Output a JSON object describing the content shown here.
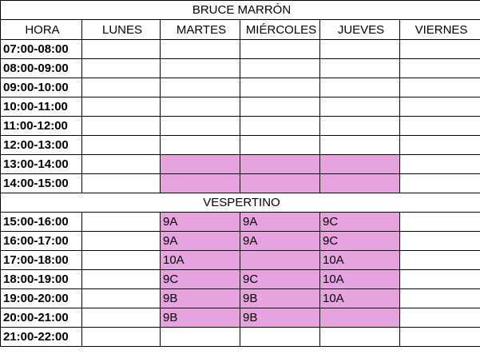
{
  "title": "BRUCE MARRÓN",
  "section_label": "VESPERTINO",
  "colors": {
    "highlight": "#e6a3e0",
    "border": "#000000"
  },
  "headers": [
    "HORA",
    "LUNES",
    "MARTES",
    "MIÉRCOLES",
    "JUEVES",
    "VIERNES"
  ],
  "morning_rows": [
    {
      "time": "07:00-08:00",
      "cells": [
        "",
        "",
        "",
        "",
        ""
      ],
      "highlight": [
        false,
        false,
        false,
        false,
        false
      ]
    },
    {
      "time": "08:00-09:00",
      "cells": [
        "",
        "",
        "",
        "",
        ""
      ],
      "highlight": [
        false,
        false,
        false,
        false,
        false
      ]
    },
    {
      "time": "09:00-10:00",
      "cells": [
        "",
        "",
        "",
        "",
        ""
      ],
      "highlight": [
        false,
        false,
        false,
        false,
        false
      ]
    },
    {
      "time": "10:00-11:00",
      "cells": [
        "",
        "",
        "",
        "",
        ""
      ],
      "highlight": [
        false,
        false,
        false,
        false,
        false
      ]
    },
    {
      "time": "11:00-12:00",
      "cells": [
        "",
        "",
        "",
        "",
        ""
      ],
      "highlight": [
        false,
        false,
        false,
        false,
        false
      ]
    },
    {
      "time": "12:00-13:00",
      "cells": [
        "",
        "",
        "",
        "",
        ""
      ],
      "highlight": [
        false,
        false,
        false,
        false,
        false
      ]
    },
    {
      "time": "13:00-14:00",
      "cells": [
        "",
        "",
        "",
        "",
        ""
      ],
      "highlight": [
        false,
        true,
        true,
        true,
        false
      ]
    },
    {
      "time": "14:00-15:00",
      "cells": [
        "",
        "",
        "",
        "",
        ""
      ],
      "highlight": [
        false,
        true,
        true,
        true,
        false
      ]
    }
  ],
  "evening_rows": [
    {
      "time": "15:00-16:00",
      "cells": [
        "",
        "9A",
        "9A",
        "9C",
        ""
      ],
      "highlight": [
        false,
        true,
        true,
        true,
        false
      ]
    },
    {
      "time": "16:00-17:00",
      "cells": [
        "",
        "9A",
        "9A",
        "9C",
        ""
      ],
      "highlight": [
        false,
        true,
        true,
        true,
        false
      ]
    },
    {
      "time": "17:00-18:00",
      "cells": [
        "",
        "10A",
        "",
        "10A",
        ""
      ],
      "highlight": [
        false,
        true,
        true,
        true,
        false
      ]
    },
    {
      "time": "18:00-19:00",
      "cells": [
        "",
        "9C",
        "9C",
        "10A",
        ""
      ],
      "highlight": [
        false,
        true,
        true,
        true,
        false
      ]
    },
    {
      "time": "19:00-20:00",
      "cells": [
        "",
        "9B",
        "9B",
        "10A",
        ""
      ],
      "highlight": [
        false,
        true,
        true,
        true,
        false
      ]
    },
    {
      "time": "20:00-21:00",
      "cells": [
        "",
        "9B",
        "9B",
        "",
        ""
      ],
      "highlight": [
        false,
        true,
        true,
        true,
        false
      ]
    },
    {
      "time": "21:00-22:00",
      "cells": [
        "",
        "",
        "",
        "",
        ""
      ],
      "highlight": [
        false,
        false,
        false,
        false,
        false
      ]
    }
  ]
}
